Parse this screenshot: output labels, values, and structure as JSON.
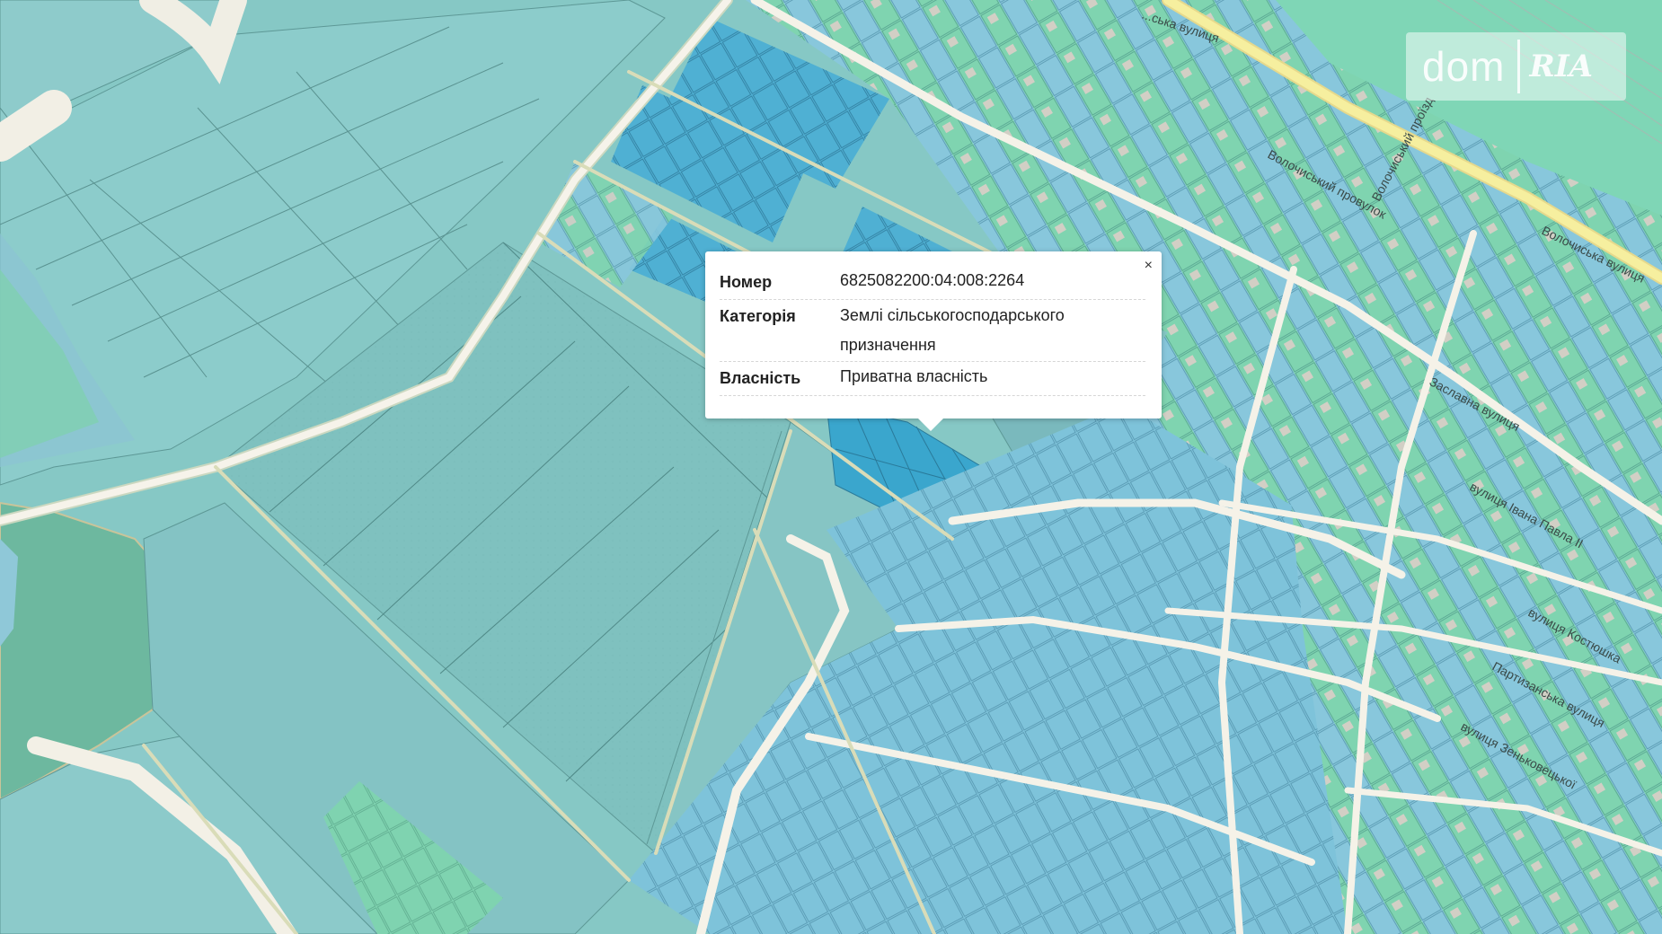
{
  "popup": {
    "close_label": "×",
    "rows": [
      {
        "key": "Номер",
        "value": "6825082200:04:008:2264"
      },
      {
        "key": "Категорія",
        "value": "Землі сільськогосподарського призначення"
      },
      {
        "key": "Власність",
        "value": "Приватна власність"
      }
    ]
  },
  "watermark": {
    "left": "dom",
    "right": "RIA"
  },
  "streets": [
    "...ська вулиця",
    "Волочиська вулиця",
    "Волочиський провулок",
    "Волочиський проїзд",
    "Заславна вулиця",
    "вулиця Івана Павла II",
    "вулиця Костюшка",
    "Партизанська вулиця",
    "вулиця Зеньковецької"
  ],
  "colors": {
    "field": "#88c9c6",
    "field_dark": "#79bdb9",
    "parcel_green": "#7fd4b0",
    "parcel_blue": "#7cc2d8",
    "selected": "#39a7cc",
    "highlight_blue": "#52b2d3",
    "road": "#f5f2e8",
    "forest": "#6fb8a3"
  }
}
